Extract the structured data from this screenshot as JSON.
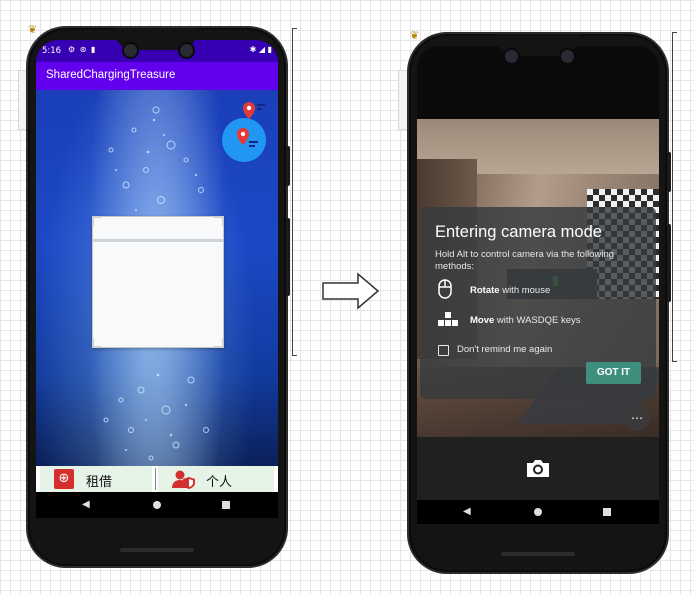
{
  "left_phone": {
    "status_bar": {
      "time": "5:16"
    },
    "app_title": "SharedChargingTreasure",
    "bottom_nav": {
      "tabs": [
        {
          "label": "租借",
          "icon": "globe-icon"
        },
        {
          "label": "个人",
          "icon": "user-shield-icon"
        }
      ],
      "tab_background": "#e5f4e7"
    },
    "colors": {
      "status_bar": "#3700b3",
      "app_bar": "#6200ee",
      "map_badge": "#2196f3",
      "pin": "#e53935"
    }
  },
  "arrow": {
    "icon": "right-arrow-icon"
  },
  "right_phone": {
    "overlay": {
      "title": "Entering camera mode",
      "subtitle": "Hold Alt to control camera via the following methods:",
      "rows": [
        {
          "bold": "Rotate",
          "text": " with mouse",
          "icon": "mouse-icon"
        },
        {
          "bold": "Move",
          "text": " with WASDQE keys",
          "icon": "keys-icon"
        }
      ],
      "checkbox_label": "Don't remind me again",
      "button_label": "GOT IT",
      "more_label": "…"
    },
    "colors": {
      "button": "#3f8f7f"
    }
  }
}
